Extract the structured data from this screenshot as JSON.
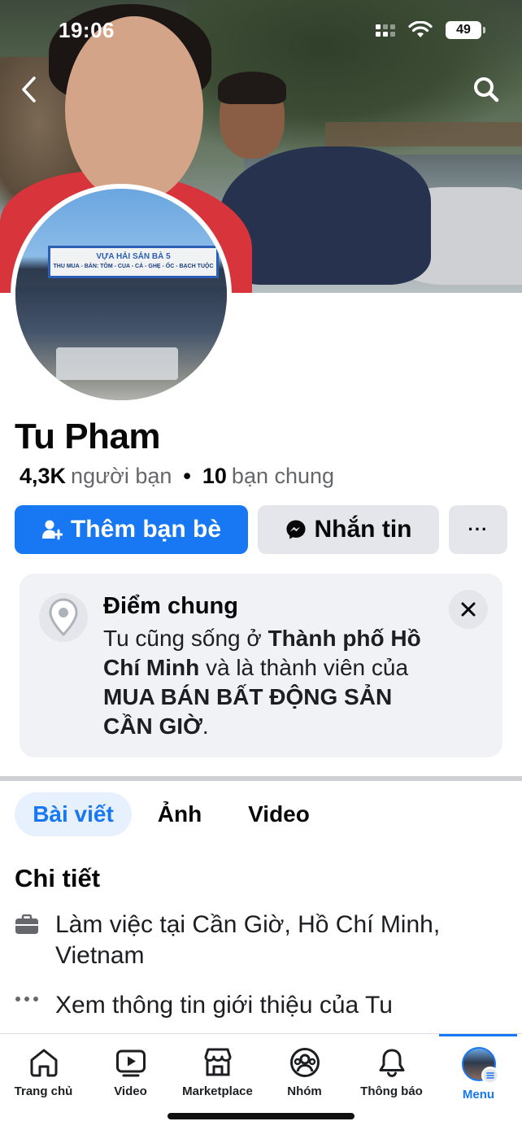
{
  "status": {
    "time": "19:06",
    "battery": "49"
  },
  "profile": {
    "name": "Tu Pham",
    "friends_count": "4,3K",
    "friends_label": "người bạn",
    "mutual_count": "10",
    "mutual_label": "bạn chung",
    "avatar_sign_line1": "VỰA HẢI SẢN BÀ 5",
    "avatar_sign_line2": "THU MUA - BÁN: TÔM - CUA - CÁ - GHẸ - ỐC - BẠCH TUỘC"
  },
  "actions": {
    "add_friend": "Thêm bạn bè",
    "message": "Nhắn tin",
    "more": "···"
  },
  "common": {
    "title": "Điểm chung",
    "text_1": "Tu cũng sống ở ",
    "bold_1": "Thành phố Hồ Chí Minh",
    "text_2": " và là thành viên của ",
    "bold_2": "MUA BÁN BẤT ĐỘNG SẢN CẦN GIỜ",
    "text_3": "."
  },
  "tabs": [
    "Bài viết",
    "Ảnh",
    "Video"
  ],
  "details": {
    "title": "Chi tiết",
    "work": "Làm việc tại Cần Giờ, Hồ Chí Minh, Vietnam",
    "about": "Xem thông tin giới thiệu của Tu"
  },
  "nav": [
    {
      "label": "Trang chủ",
      "icon": "home-icon"
    },
    {
      "label": "Video",
      "icon": "video-icon"
    },
    {
      "label": "Marketplace",
      "icon": "marketplace-icon"
    },
    {
      "label": "Nhóm",
      "icon": "groups-icon"
    },
    {
      "label": "Thông báo",
      "icon": "bell-icon"
    },
    {
      "label": "Menu",
      "icon": "menu-avatar"
    }
  ],
  "colors": {
    "accent": "#1877f2",
    "secondary_button": "#e4e6eb",
    "card_bg": "#f0f2f5"
  }
}
